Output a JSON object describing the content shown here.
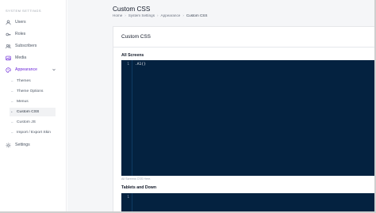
{
  "sidebar": {
    "heading": "SYSTEM SETTINGS",
    "items": [
      {
        "label": "Users",
        "icon": "user-icon"
      },
      {
        "label": "Roles",
        "icon": "key-icon"
      },
      {
        "label": "Subscribers",
        "icon": "subscribers-icon"
      },
      {
        "label": "Media",
        "icon": "image-icon"
      },
      {
        "label": "Appearance",
        "icon": "palette-icon"
      }
    ],
    "subitems": [
      {
        "label": "Themes"
      },
      {
        "label": "Theme Options"
      },
      {
        "label": "Menus"
      },
      {
        "label": "Custom CSS"
      },
      {
        "label": "Custom JS"
      },
      {
        "label": "Import / Export Skin"
      }
    ],
    "settings": {
      "label": "Settings",
      "icon": "gear-icon"
    }
  },
  "header": {
    "title": "Custom CSS",
    "breadcrumb": [
      "Home",
      "System Settings",
      "Appearance",
      "Custom CSS"
    ]
  },
  "card": {
    "title": "Custom CSS",
    "sections": [
      {
        "label": "All Screens",
        "line_number": "1",
        "code": ".A1{}",
        "help": "All Screens CSS Here."
      },
      {
        "label": "Tablets and Down",
        "line_number": "1",
        "code": ""
      }
    ]
  },
  "colors": {
    "accent": "#6d28d9",
    "editor_bg": "#042240"
  }
}
